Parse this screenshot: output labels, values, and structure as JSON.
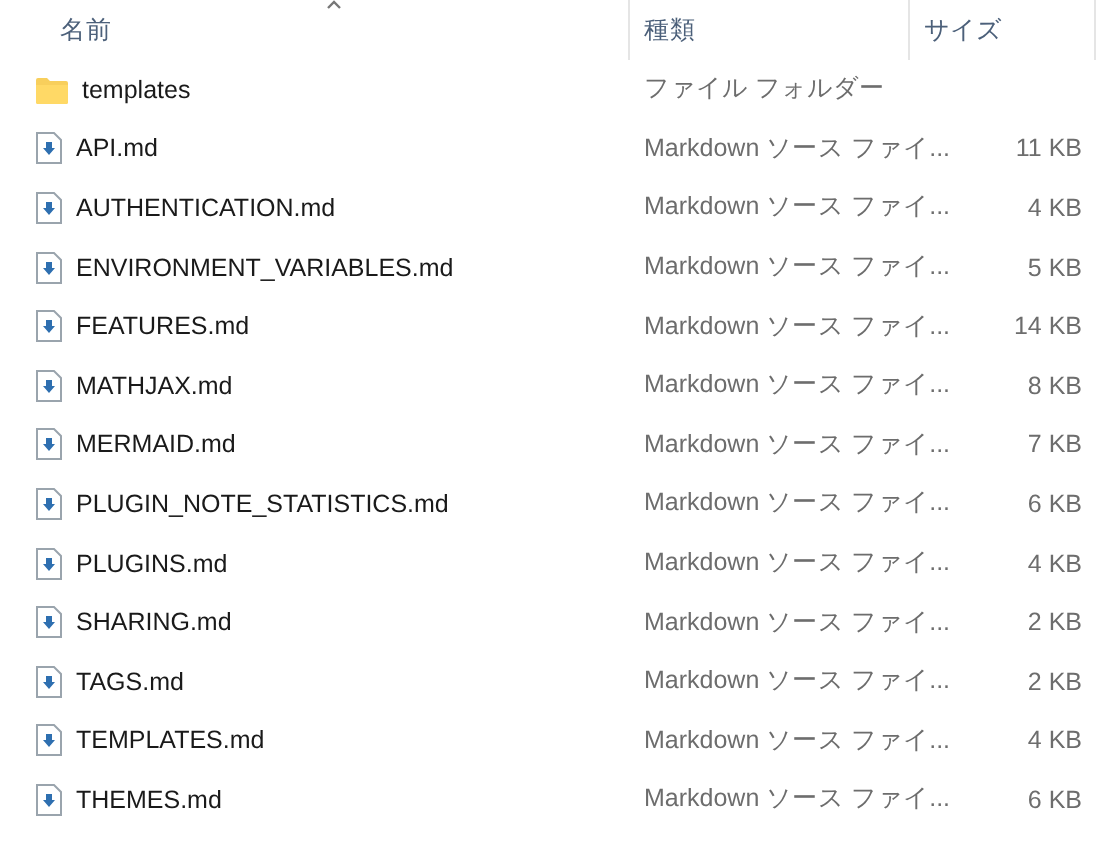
{
  "columns": [
    {
      "label": "名前",
      "sorted": true
    },
    {
      "label": "種類",
      "sorted": false
    },
    {
      "label": "サイズ",
      "sorted": false
    }
  ],
  "rows": [
    {
      "kind": "folder",
      "name": "templates",
      "type": "ファイル フォルダー"
    },
    {
      "kind": "file",
      "name": "API.md",
      "type": "Markdown ソース ファイ...",
      "size": "11 KB"
    },
    {
      "kind": "file",
      "name": "AUTHENTICATION.md",
      "type": "Markdown ソース ファイ...",
      "size": "4 KB"
    },
    {
      "kind": "file",
      "name": "ENVIRONMENT_VARIABLES.md",
      "type": "Markdown ソース ファイ...",
      "size": "5 KB"
    },
    {
      "kind": "file",
      "name": "FEATURES.md",
      "type": "Markdown ソース ファイ...",
      "size": "14 KB"
    },
    {
      "kind": "file",
      "name": "MATHJAX.md",
      "type": "Markdown ソース ファイ...",
      "size": "8 KB"
    },
    {
      "kind": "file",
      "name": "MERMAID.md",
      "type": "Markdown ソース ファイ...",
      "size": "7 KB"
    },
    {
      "kind": "file",
      "name": "PLUGIN_NOTE_STATISTICS.md",
      "type": "Markdown ソース ファイ...",
      "size": "6 KB"
    },
    {
      "kind": "file",
      "name": "PLUGINS.md",
      "type": "Markdown ソース ファイ...",
      "size": "4 KB"
    },
    {
      "kind": "file",
      "name": "SHARING.md",
      "type": "Markdown ソース ファイ...",
      "size": "2 KB"
    },
    {
      "kind": "file",
      "name": "TAGS.md",
      "type": "Markdown ソース ファイ...",
      "size": "2 KB"
    },
    {
      "kind": "file",
      "name": "TEMPLATES.md",
      "type": "Markdown ソース ファイ...",
      "size": "4 KB"
    },
    {
      "kind": "file",
      "name": "THEMES.md",
      "type": "Markdown ソース ファイ...",
      "size": "6 KB"
    }
  ]
}
